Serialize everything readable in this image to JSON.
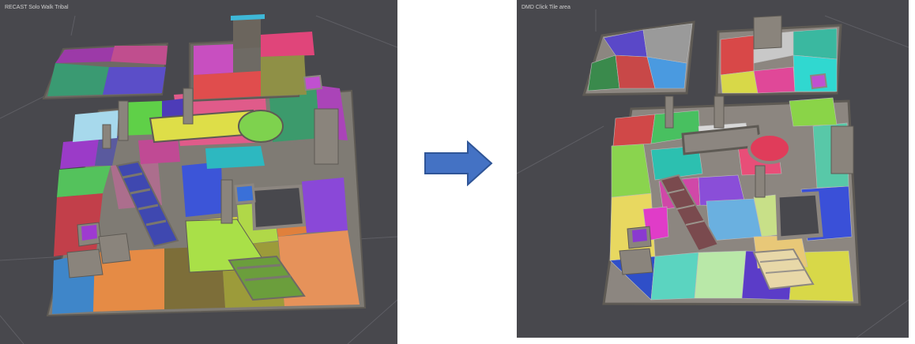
{
  "left_viewport": {
    "label_line1": "RECAST Solo  Walk Tribal",
    "label_line2": ""
  },
  "right_viewport": {
    "label_line1": "DMD Click Tile area",
    "label_line2": ""
  },
  "colors": {
    "viewport_bg": "#48484d",
    "grid_line": "#5d5d63",
    "wall": "#8c8680",
    "wall_dark": "#5e5a54",
    "arrow_fill": "#4472c4",
    "arrow_stroke": "#2f5597"
  },
  "icons": {
    "transition_arrow": "right-arrow-icon"
  }
}
